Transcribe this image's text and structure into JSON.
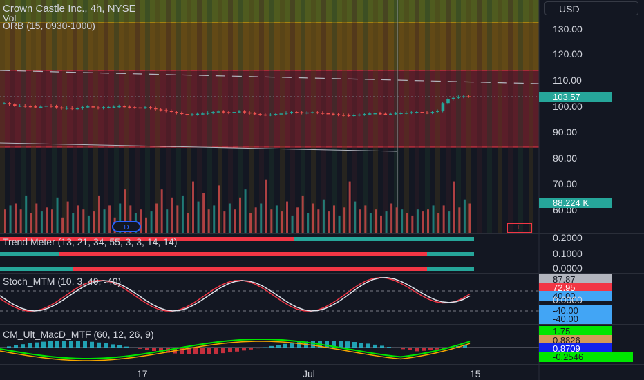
{
  "header": {
    "title": "Crown Castle Inc., 4h, NYSE",
    "vol_label": "Vol",
    "orb_label": "ORB (15, 0930-1000)"
  },
  "currency": "USD",
  "price_axis": [
    "130.00",
    "120.00",
    "110.00",
    "100.00",
    "90.00",
    "80.00",
    "70.00",
    "60.00"
  ],
  "last_price": "103.57",
  "volume_tag": "88.224 K",
  "earnings_badge": "E",
  "dividend_badge": "D",
  "trend_meter": {
    "label": "Trend Meter (13, 21, 34, 55, 3, 3, 14, 14)",
    "axis": [
      "0.2000",
      "0.1000",
      "0.0000"
    ]
  },
  "stoch": {
    "label": "Stoch_MTM (10, 3, 40, -40)",
    "axis_value": "0.0000",
    "tags": [
      "87.87",
      "72.95",
      "40.00",
      "-40.00",
      "-40.00"
    ]
  },
  "macd": {
    "label": "CM_Ult_MacD_MTF (60, 12, 26, 9)",
    "tags": [
      "1.75",
      "0.8826",
      "0.8709",
      "-0.2546"
    ]
  },
  "time_axis": [
    "17",
    "Jul",
    "15"
  ],
  "colors": {
    "up": "#26a69a",
    "down": "#ef5350",
    "bg": "#131722",
    "orb_band": "#f7a600",
    "range_band": "#b22833"
  },
  "chart_data": {
    "type": "candlestick",
    "price_axis_ticks": [
      60,
      70,
      80,
      90,
      100,
      110,
      120,
      130
    ],
    "last_price": 103.57,
    "candles_close": [
      101,
      100.5,
      100,
      100,
      99.8,
      99.7,
      99.5,
      99.6,
      100,
      99.8,
      99.3,
      99,
      99.2,
      98.9,
      99,
      99.5,
      99.7,
      99.3,
      99.1,
      99.4,
      99.5,
      99.6,
      99.8,
      99.6,
      99.4,
      99.3,
      99.2,
      99.4,
      99.1,
      98.6,
      98.3,
      98,
      97.6,
      97.2,
      96.8,
      96.5,
      96.7,
      96.9,
      97,
      97.3,
      97.6,
      97.8,
      97.5,
      97.3,
      97.6,
      97.8,
      97.4,
      97.1,
      96.8,
      96.6,
      96.5,
      96.6,
      96.8,
      97,
      97.3,
      97.6,
      97.5,
      97.2,
      97.4,
      97.5,
      97.3,
      97.1,
      96.9,
      96.7,
      96.5,
      96.4,
      96.3,
      96.4,
      96.6,
      96.8,
      97,
      97.1,
      96.9,
      96.8,
      96.9,
      97.1,
      97.2,
      97.3,
      97.5,
      97.6,
      97.4,
      97.3,
      97.6,
      98,
      101,
      102.5,
      103,
      103.4,
      103.6,
      103.57
    ],
    "volume": [
      12,
      14,
      15,
      12,
      19,
      10,
      15,
      11,
      13,
      12,
      18,
      8,
      16,
      10,
      14,
      12,
      9,
      11,
      19,
      12,
      14,
      8,
      15,
      22,
      14,
      10,
      12,
      8,
      11,
      15,
      22,
      12,
      18,
      14,
      19,
      10,
      26,
      16,
      20,
      12,
      14,
      24,
      11,
      15,
      12,
      18,
      22,
      10,
      13,
      15,
      27,
      12,
      14,
      11,
      16,
      9,
      13,
      19,
      10,
      15,
      12,
      17,
      11,
      14,
      9,
      13,
      26,
      16,
      12,
      14,
      10,
      12,
      9,
      11,
      15,
      13,
      12,
      10,
      9,
      12,
      11,
      12,
      14,
      10,
      14,
      11,
      26,
      13,
      17,
      15
    ]
  }
}
